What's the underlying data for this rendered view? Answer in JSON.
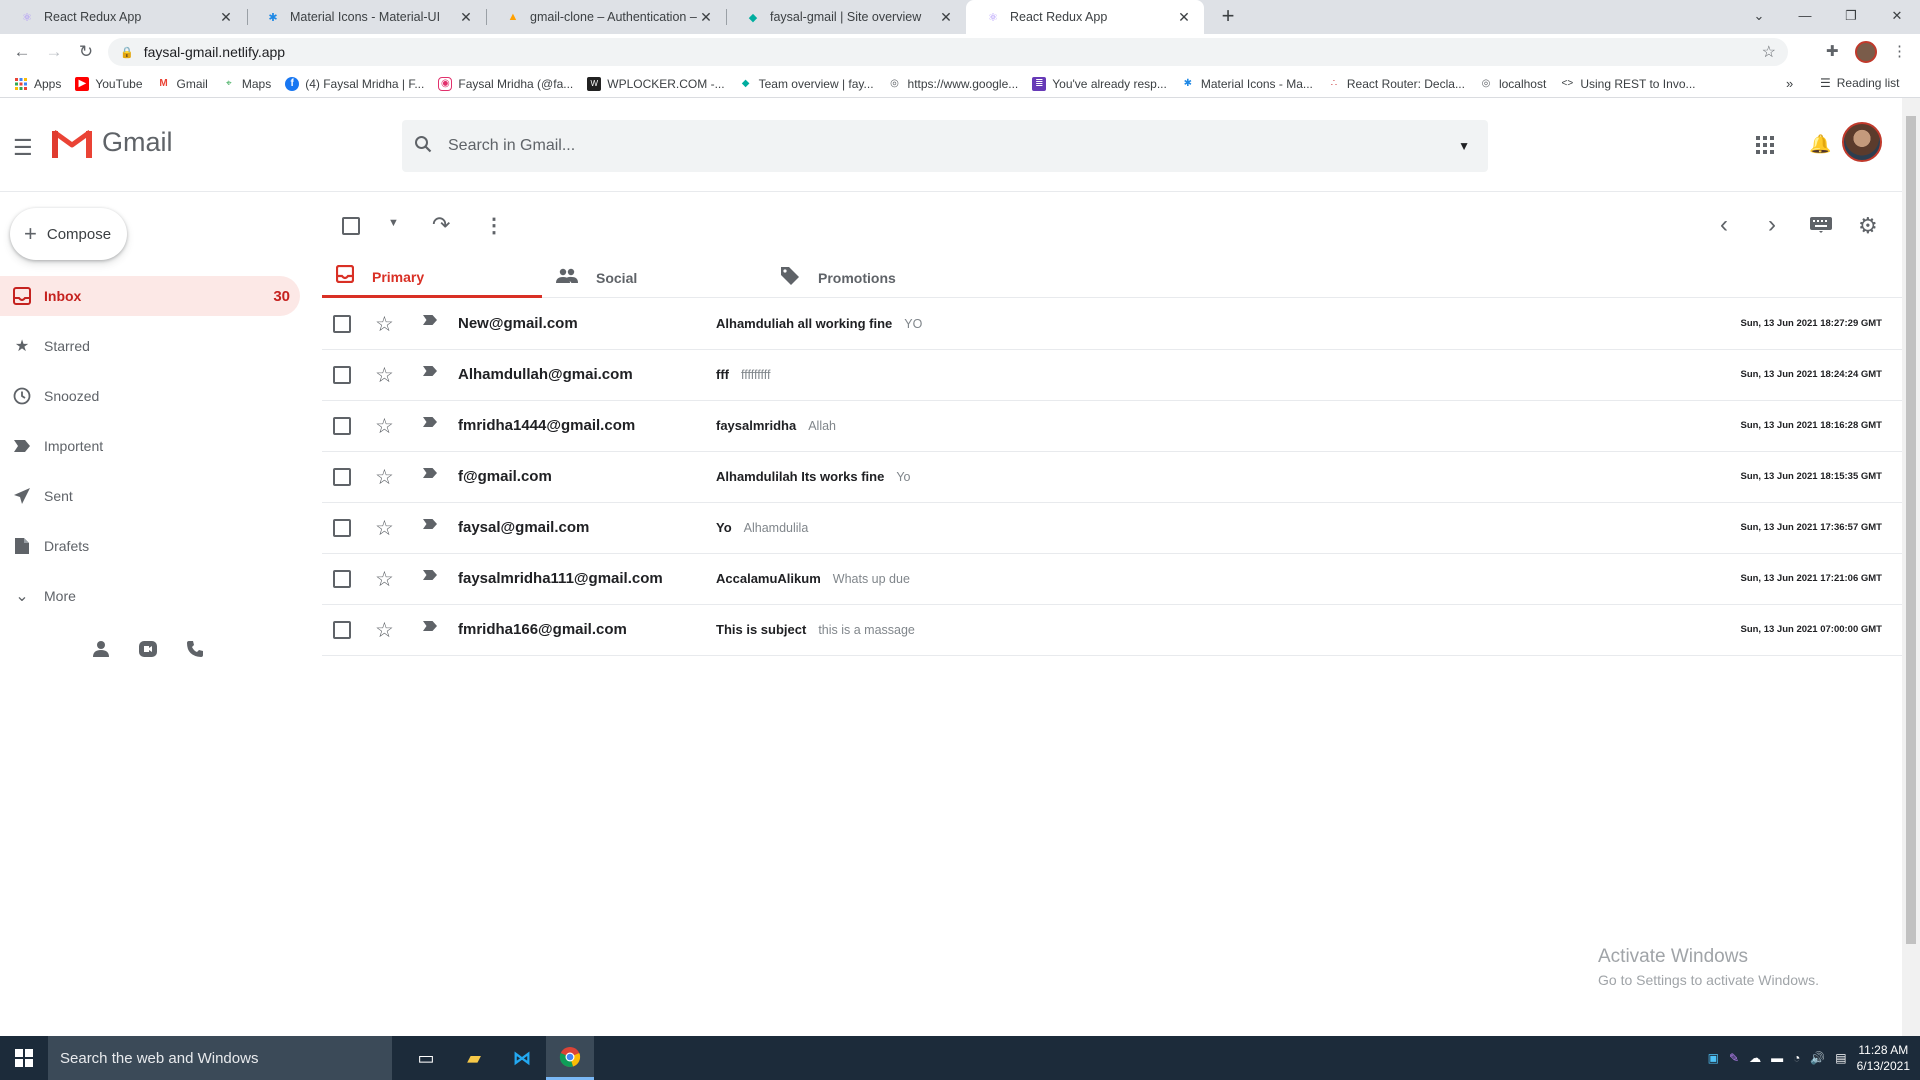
{
  "browser": {
    "tabs": [
      {
        "title": "React Redux App",
        "icon_color": "#a78bfa"
      },
      {
        "title": "Material Icons - Material-UI",
        "icon_color": "#1e88e5"
      },
      {
        "title": "gmail-clone – Authentication – F",
        "icon_color": "#ffa000"
      },
      {
        "title": "faysal-gmail | Site overview",
        "icon_color": "#00ad9f"
      },
      {
        "title": "React Redux App",
        "icon_color": "#a78bfa"
      }
    ],
    "new_tab_label": "+",
    "url": "faysal-gmail.netlify.app",
    "bookmarks": [
      {
        "label": "Apps",
        "icon_color": "#ea4335"
      },
      {
        "label": "YouTube",
        "icon_color": "#ff0000"
      },
      {
        "label": "Gmail",
        "icon_color": "#ea4335"
      },
      {
        "label": "Maps",
        "icon_color": "#34a853"
      },
      {
        "label": "(4) Faysal Mridha | F...",
        "icon_color": "#1877f2"
      },
      {
        "label": "Faysal Mridha (@fa...",
        "icon_color": "#e1306c"
      },
      {
        "label": "WPLOCKER.COM -...",
        "icon_color": "#222222"
      },
      {
        "label": "Team overview | fay...",
        "icon_color": "#00ad9f"
      },
      {
        "label": "https://www.google...",
        "icon_color": "#5f6368"
      },
      {
        "label": "You've already resp...",
        "icon_color": "#673ab7"
      },
      {
        "label": "Material Icons - Ma...",
        "icon_color": "#1e88e5"
      },
      {
        "label": "React Router: Decla...",
        "icon_color": "#ca4245"
      },
      {
        "label": "localhost",
        "icon_color": "#5f6368"
      },
      {
        "label": "Using REST to Invo...",
        "icon_color": "#3c4043"
      }
    ],
    "bookmarks_more": "»",
    "reading_list": "Reading list"
  },
  "gmail": {
    "logo_text": "Gmail",
    "search_placeholder": "Search in Gmail...",
    "compose_label": "Compose",
    "sidebar": [
      {
        "label": "Inbox",
        "icon": "inbox-icon",
        "count": "30",
        "active": true
      },
      {
        "label": "Starred",
        "icon": "star-icon",
        "count": ""
      },
      {
        "label": "Snoozed",
        "icon": "clock-icon",
        "count": ""
      },
      {
        "label": "Importent",
        "icon": "label-important-icon",
        "count": ""
      },
      {
        "label": "Sent",
        "icon": "send-icon",
        "count": ""
      },
      {
        "label": "Drafets",
        "icon": "draft-icon",
        "count": ""
      },
      {
        "label": "More",
        "icon": "expand-more-icon",
        "count": ""
      }
    ],
    "categories": [
      {
        "label": "Primary",
        "icon": "inbox-icon",
        "active": true
      },
      {
        "label": "Social",
        "icon": "people-icon"
      },
      {
        "label": "Promotions",
        "icon": "local-offer-icon"
      }
    ],
    "emails": [
      {
        "from": "New@gmail.com",
        "subject": "Alhamduliah all working fine",
        "snippet": "YO",
        "date": "Sun, 13 Jun 2021 18:27:29 GMT"
      },
      {
        "from": "Alhamdullah@gmai.com",
        "subject": "fff",
        "snippet": "fffffffff",
        "date": "Sun, 13 Jun 2021 18:24:24 GMT"
      },
      {
        "from": "fmridha1444@gmail.com",
        "subject": "faysalmridha",
        "snippet": "Allah",
        "date": "Sun, 13 Jun 2021 18:16:28 GMT"
      },
      {
        "from": "f@gmail.com",
        "subject": "Alhamdulilah Its works fine",
        "snippet": "Yo",
        "date": "Sun, 13 Jun 2021 18:15:35 GMT"
      },
      {
        "from": "faysal@gmail.com",
        "subject": "Yo",
        "snippet": "Alhamdulila",
        "date": "Sun, 13 Jun 2021 17:36:57 GMT"
      },
      {
        "from": "faysalmridha111@gmail.com",
        "subject": "AccalamuAlikum",
        "snippet": "Whats up due",
        "date": "Sun, 13 Jun 2021 17:21:06 GMT"
      },
      {
        "from": "fmridha166@gmail.com",
        "subject": "This is subject",
        "snippet": "this is a massage",
        "date": "Sun, 13 Jun 2021 07:00:00 GMT"
      }
    ]
  },
  "watermark": {
    "line1": "Activate Windows",
    "line2": "Go to Settings to activate Windows."
  },
  "taskbar": {
    "search_placeholder": "Search the web and Windows",
    "time": "11:28 AM",
    "date": "6/13/2021"
  },
  "colors": {
    "accent_red": "#d93025",
    "inbox_bg": "#fce8e6"
  }
}
